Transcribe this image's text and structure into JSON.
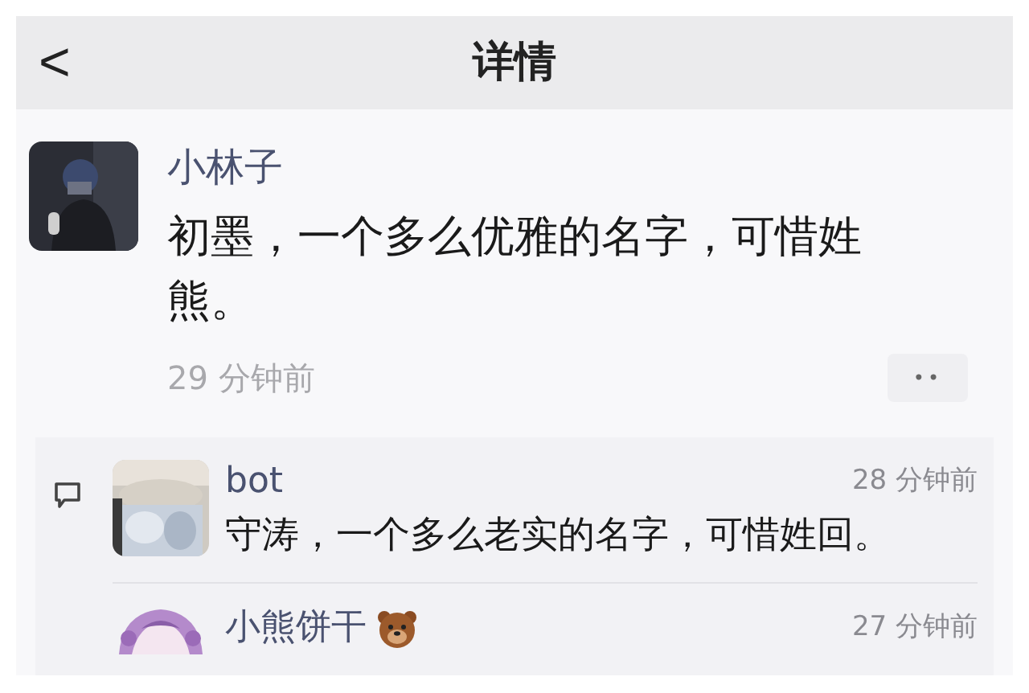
{
  "header": {
    "back": "<",
    "title": "详情"
  },
  "post": {
    "author": "小林子",
    "text": "初墨，一个多么优雅的名字，可惜姓熊。",
    "time": "29 分钟前",
    "more": "••"
  },
  "replies": [
    {
      "author": "bot",
      "time": "28 分钟前",
      "text": "守涛，一个多么老实的名字，可惜姓回。",
      "badge": false
    },
    {
      "author": "小熊饼干",
      "time": "27 分钟前",
      "badge": true
    }
  ]
}
